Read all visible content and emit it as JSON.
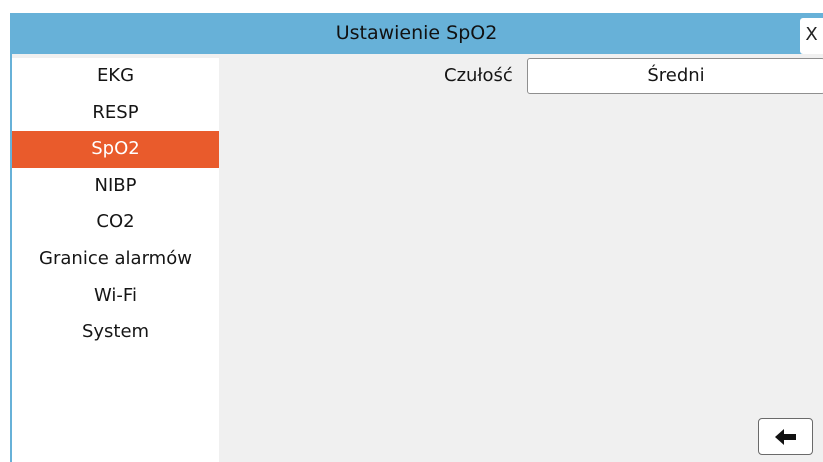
{
  "window": {
    "title": "Ustawienie SpO2",
    "close_label": "X"
  },
  "sidebar": {
    "items": [
      {
        "label": "EKG",
        "active": false
      },
      {
        "label": "RESP",
        "active": false
      },
      {
        "label": "SpO2",
        "active": true
      },
      {
        "label": "NIBP",
        "active": false
      },
      {
        "label": "CO2",
        "active": false
      },
      {
        "label": "Granice alarmów",
        "active": false
      },
      {
        "label": "Wi-Fi",
        "active": false
      },
      {
        "label": "System",
        "active": false
      }
    ]
  },
  "settings": {
    "sensitivity_label": "Czułość",
    "sensitivity_value": "Średni"
  },
  "footer": {
    "back_icon": "arrow-left-icon"
  },
  "colors": {
    "title_bar": "#67b1d8",
    "active_item": "#e95b2c",
    "panel_background": "#f0f0f0"
  }
}
